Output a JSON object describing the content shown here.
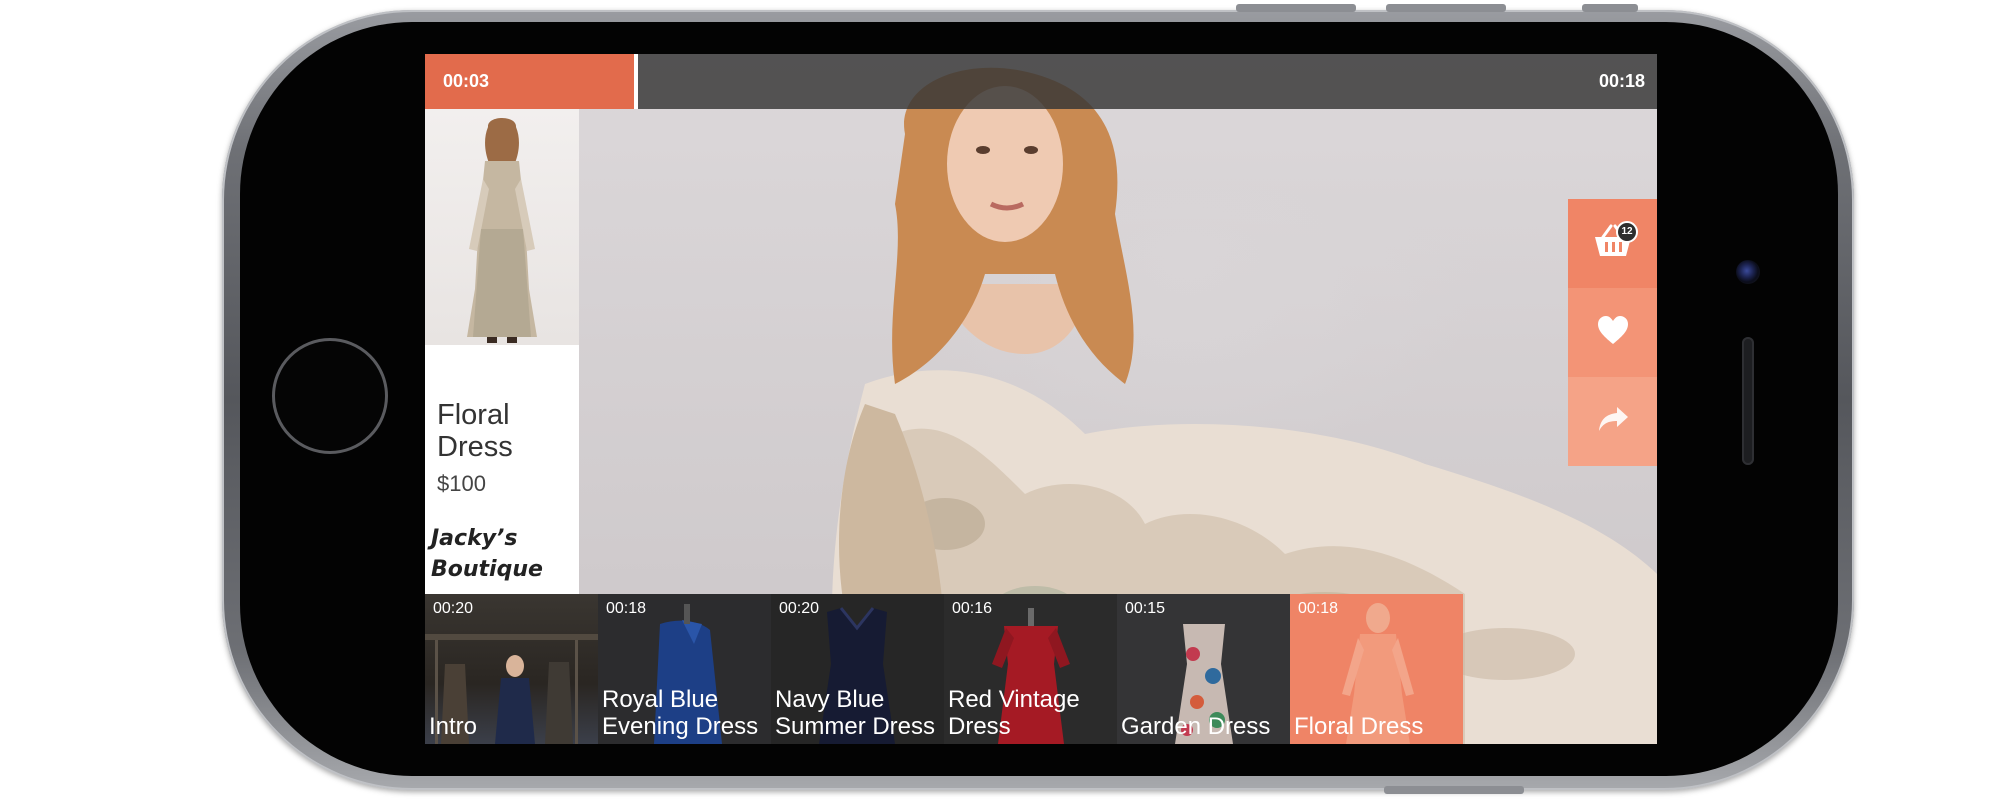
{
  "player": {
    "elapsed": "00:03",
    "duration": "00:18",
    "progress_fraction": 0.17
  },
  "product": {
    "name": "Floral Dress",
    "price": "$100",
    "store": "Jacky’s Boutique"
  },
  "actions": {
    "cart_icon": "shopping-basket-icon",
    "cart_count": "12",
    "like_icon": "heart-icon",
    "share_icon": "share-arrow-icon"
  },
  "playlist": {
    "items": [
      {
        "duration": "00:20",
        "title": "Intro",
        "active": false
      },
      {
        "duration": "00:18",
        "title": "Royal Blue Evening Dress",
        "active": false
      },
      {
        "duration": "00:20",
        "title": "Navy Blue Summer Dress",
        "active": false
      },
      {
        "duration": "00:16",
        "title": "Red Vintage Dress",
        "active": false
      },
      {
        "duration": "00:15",
        "title": "Garden Dress",
        "active": false
      },
      {
        "duration": "00:18",
        "title": "Floral Dress",
        "active": true
      }
    ]
  },
  "colors": {
    "accent": "#e26b4c",
    "accent_light": "#f08566",
    "frame": "#6e7075"
  }
}
